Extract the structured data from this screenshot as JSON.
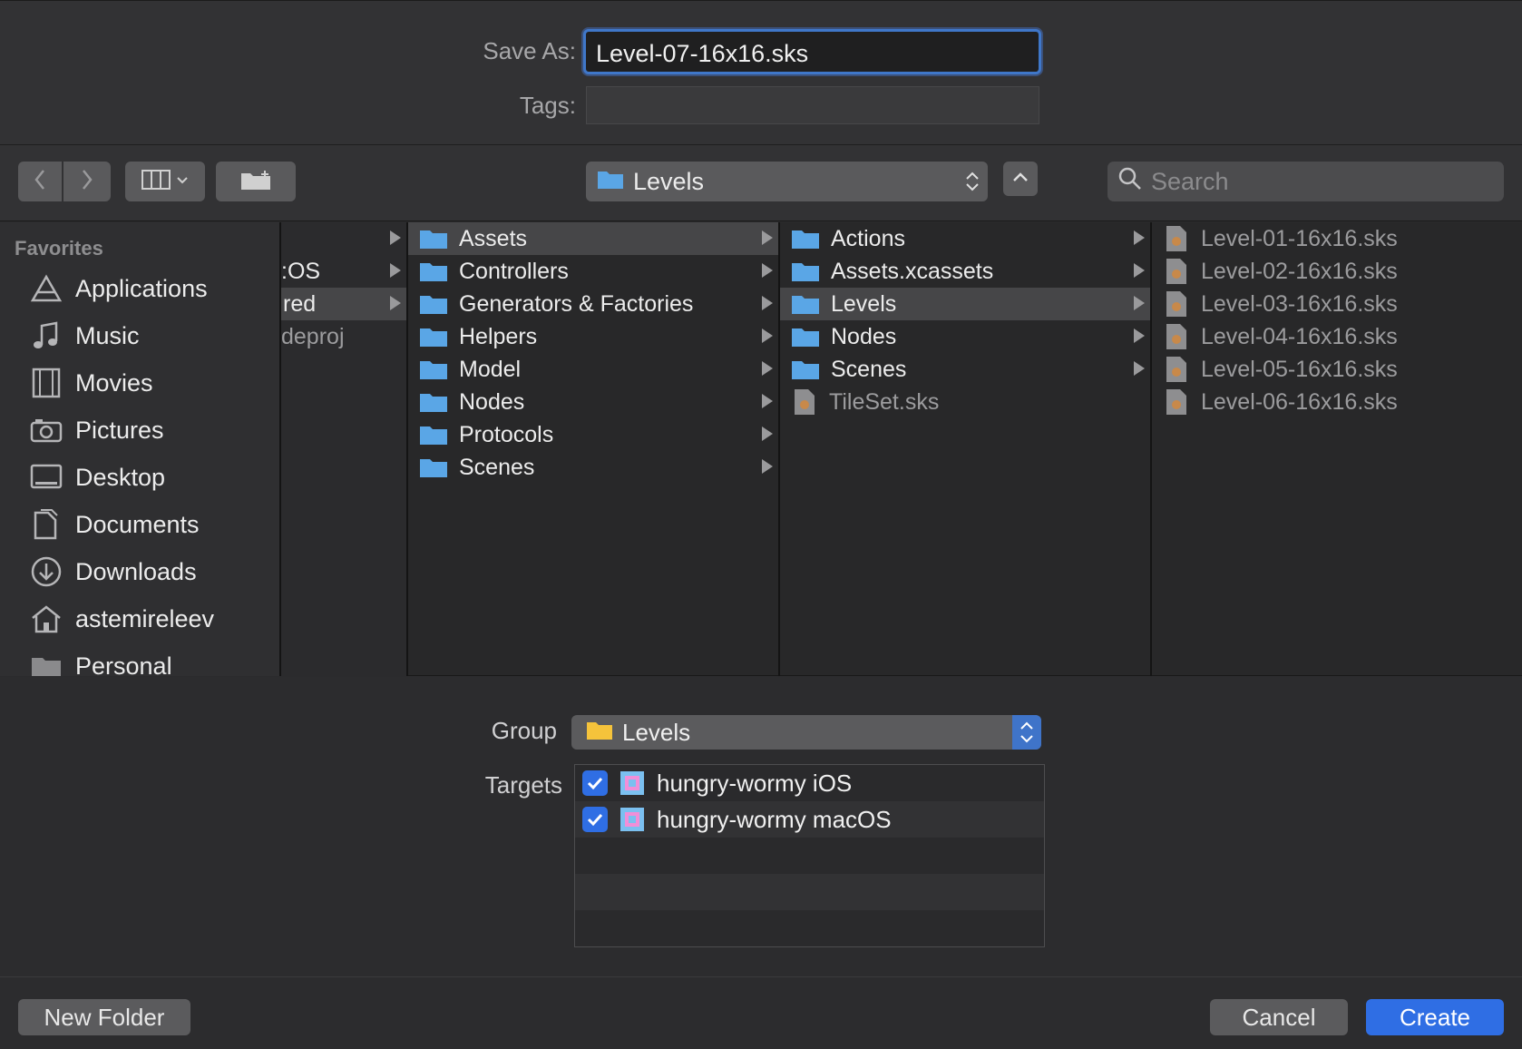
{
  "save_panel": {
    "save_as_label": "Save As:",
    "save_as_value": "Level-07-16x16.sks",
    "tags_label": "Tags:",
    "tags_value": ""
  },
  "toolbar": {
    "path_popup_label": "Levels",
    "search_placeholder": "Search"
  },
  "sidebar": {
    "heading": "Favorites",
    "items": [
      {
        "label": "Applications",
        "icon": "applications-icon"
      },
      {
        "label": "Music",
        "icon": "music-icon"
      },
      {
        "label": "Movies",
        "icon": "movies-icon"
      },
      {
        "label": "Pictures",
        "icon": "pictures-icon"
      },
      {
        "label": "Desktop",
        "icon": "desktop-icon"
      },
      {
        "label": "Documents",
        "icon": "documents-icon"
      },
      {
        "label": "Downloads",
        "icon": "downloads-icon"
      },
      {
        "label": "astemireleev",
        "icon": "home-icon"
      },
      {
        "label": "Personal",
        "icon": "folder-icon"
      }
    ]
  },
  "columns": {
    "col0": [
      ":OS",
      "red",
      "deproj"
    ],
    "col1": [
      "Assets",
      "Controllers",
      "Generators & Factories",
      "Helpers",
      "Model",
      "Nodes",
      "Protocols",
      "Scenes"
    ],
    "col2_folders": [
      "Actions",
      "Assets.xcassets",
      "Levels",
      "Nodes",
      "Scenes"
    ],
    "col2_file": "TileSet.sks",
    "col3_files": [
      "Level-01-16x16.sks",
      "Level-02-16x16.sks",
      "Level-03-16x16.sks",
      "Level-04-16x16.sks",
      "Level-05-16x16.sks",
      "Level-06-16x16.sks"
    ]
  },
  "lower": {
    "group_label": "Group",
    "group_value": "Levels",
    "targets_label": "Targets",
    "targets": [
      {
        "name": "hungry-wormy iOS",
        "checked": true
      },
      {
        "name": "hungry-wormy macOS",
        "checked": true
      }
    ]
  },
  "buttons": {
    "new_folder": "New Folder",
    "cancel": "Cancel",
    "create": "Create"
  },
  "colors": {
    "accent": "#2f6ee4",
    "folder_blue": "#5aa6e6",
    "folder_yellow": "#f5c33b"
  }
}
